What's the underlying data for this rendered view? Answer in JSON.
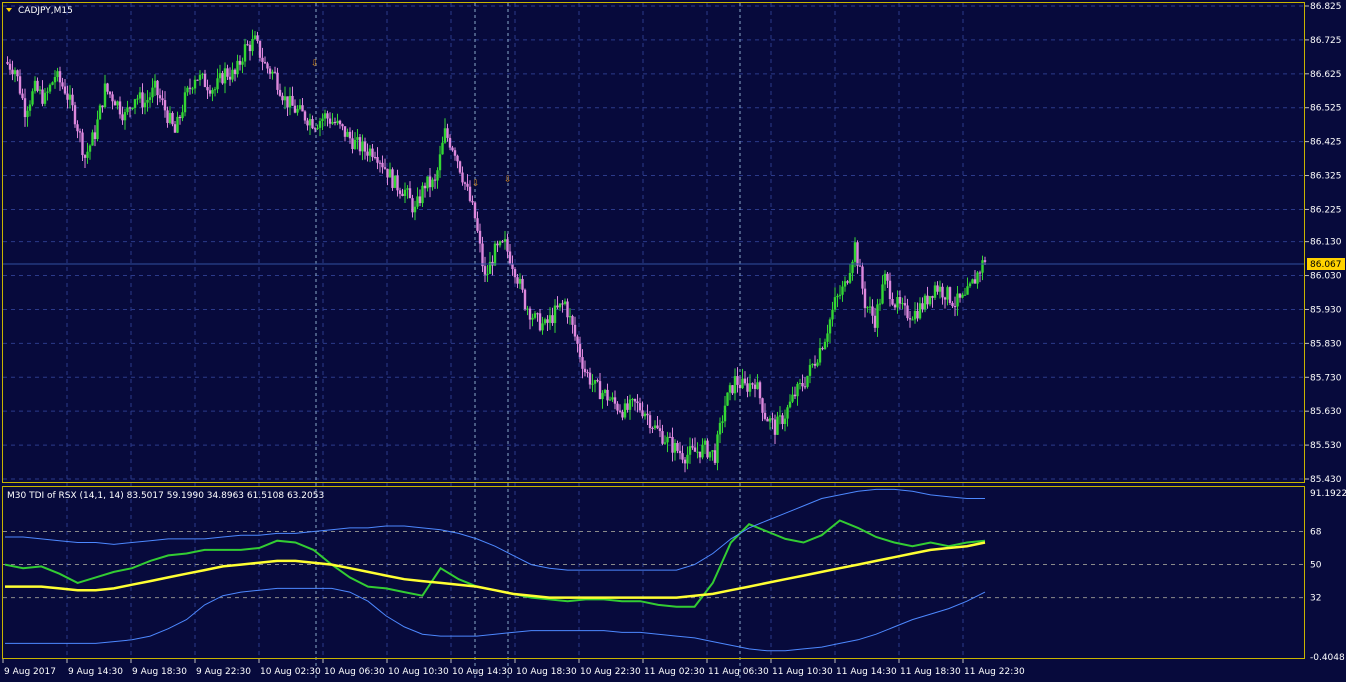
{
  "window": {
    "title": "CADJPY,M15"
  },
  "colors": {
    "background": "#070a3c",
    "grid": "#2b3a8a",
    "border": "#c8b400",
    "bull": "#33d633",
    "bear": "#dd88dd",
    "text": "#ffffff",
    "vline": "#8aa8c8",
    "price_tag_bg": "#ffd200",
    "tdi_green": "#33cc33",
    "tdi_yellow": "#ffff33",
    "tdi_blue": "#4d88ff",
    "arrow": "#d98a1a"
  },
  "price_axis": {
    "labels": [
      "86.825",
      "86.725",
      "86.625",
      "86.525",
      "86.425",
      "86.325",
      "86.225",
      "86.130",
      "86.030",
      "85.930",
      "85.830",
      "85.730",
      "85.630",
      "85.530",
      "85.430"
    ],
    "current_price": "86.067"
  },
  "indicator": {
    "label": "M30 TDI of RSX  (14,1, 14) 83.5017 59.1990 34.8963 61.5108 63.2053",
    "axis_labels": [
      "91.1922",
      "68",
      "50",
      "32",
      "-0.4048"
    ]
  },
  "time_axis": {
    "labels": [
      "9 Aug 2017",
      "9 Aug 14:30",
      "9 Aug 18:30",
      "9 Aug 22:30",
      "10 Aug 02:30",
      "10 Aug 06:30",
      "10 Aug 10:30",
      "10 Aug 14:30",
      "10 Aug 18:30",
      "10 Aug 22:30",
      "11 Aug 02:30",
      "11 Aug 06:30",
      "11 Aug 10:30",
      "11 Aug 14:30",
      "11 Aug 18:30",
      "11 Aug 22:30"
    ]
  },
  "chart_data": {
    "type": "candlestick",
    "symbol": "CADJPY",
    "timeframe": "M15",
    "y_range": [
      85.43,
      86.825
    ],
    "close_path": [
      [
        0,
        86.66
      ],
      [
        4,
        86.64
      ],
      [
        8,
        86.52
      ],
      [
        12,
        86.58
      ],
      [
        16,
        86.55
      ],
      [
        20,
        86.62
      ],
      [
        24,
        86.58
      ],
      [
        28,
        86.5
      ],
      [
        32,
        86.38
      ],
      [
        36,
        86.45
      ],
      [
        40,
        86.58
      ],
      [
        44,
        86.55
      ],
      [
        48,
        86.5
      ],
      [
        52,
        86.56
      ],
      [
        56,
        86.54
      ],
      [
        60,
        86.58
      ],
      [
        64,
        86.52
      ],
      [
        68,
        86.45
      ],
      [
        72,
        86.55
      ],
      [
        76,
        86.62
      ],
      [
        80,
        86.6
      ],
      [
        84,
        86.58
      ],
      [
        88,
        86.63
      ],
      [
        92,
        86.62
      ],
      [
        96,
        86.7
      ],
      [
        100,
        86.72
      ],
      [
        104,
        86.65
      ],
      [
        108,
        86.62
      ],
      [
        112,
        86.55
      ],
      [
        116,
        86.52
      ],
      [
        120,
        86.5
      ],
      [
        124,
        86.48
      ],
      [
        128,
        86.5
      ],
      [
        132,
        86.48
      ],
      [
        136,
        86.45
      ],
      [
        140,
        86.42
      ],
      [
        144,
        86.4
      ],
      [
        148,
        86.4
      ],
      [
        152,
        86.35
      ],
      [
        156,
        86.3
      ],
      [
        160,
        86.28
      ],
      [
        164,
        86.22
      ],
      [
        168,
        86.3
      ],
      [
        172,
        86.3
      ],
      [
        176,
        86.45
      ],
      [
        180,
        86.4
      ],
      [
        184,
        86.3
      ],
      [
        188,
        86.2
      ],
      [
        192,
        86.02
      ],
      [
        196,
        86.1
      ],
      [
        200,
        86.12
      ],
      [
        204,
        86.05
      ],
      [
        208,
        85.95
      ],
      [
        212,
        85.9
      ],
      [
        216,
        85.88
      ],
      [
        220,
        85.92
      ],
      [
        224,
        85.95
      ],
      [
        228,
        85.85
      ],
      [
        232,
        85.75
      ],
      [
        236,
        85.7
      ],
      [
        240,
        85.68
      ],
      [
        244,
        85.65
      ],
      [
        248,
        85.63
      ],
      [
        252,
        85.65
      ],
      [
        256,
        85.63
      ],
      [
        260,
        85.58
      ],
      [
        264,
        85.55
      ],
      [
        268,
        85.52
      ],
      [
        272,
        85.5
      ],
      [
        276,
        85.51
      ],
      [
        280,
        85.52
      ],
      [
        284,
        85.5
      ],
      [
        288,
        85.65
      ],
      [
        292,
        85.72
      ],
      [
        296,
        85.7
      ],
      [
        300,
        85.72
      ],
      [
        304,
        85.62
      ],
      [
        308,
        85.58
      ],
      [
        312,
        85.62
      ],
      [
        316,
        85.68
      ],
      [
        320,
        85.72
      ],
      [
        324,
        85.78
      ],
      [
        328,
        85.85
      ],
      [
        332,
        85.95
      ],
      [
        336,
        86.0
      ],
      [
        340,
        86.12
      ],
      [
        344,
        85.95
      ],
      [
        348,
        85.9
      ],
      [
        352,
        86.02
      ],
      [
        356,
        85.95
      ],
      [
        360,
        85.92
      ],
      [
        364,
        85.92
      ],
      [
        368,
        85.95
      ],
      [
        372,
        86.0
      ],
      [
        376,
        85.98
      ],
      [
        380,
        85.95
      ],
      [
        384,
        85.96
      ],
      [
        388,
        86.02
      ],
      [
        392,
        86.08
      ]
    ],
    "indicator_series": [
      {
        "name": "rsx",
        "values": [
          50,
          48,
          49,
          45,
          40,
          43,
          46,
          48,
          52,
          55,
          56,
          58,
          58,
          58,
          59,
          63,
          62,
          58,
          50,
          43,
          38,
          37,
          35,
          33,
          48,
          42,
          38,
          36,
          34,
          32,
          31,
          30,
          31,
          31,
          30,
          30,
          28,
          27,
          27,
          40,
          62,
          72,
          68,
          64,
          62,
          66,
          74,
          70,
          65,
          62,
          60,
          62,
          60,
          62,
          63
        ]
      },
      {
        "name": "signal",
        "values": [
          38,
          38,
          38,
          37,
          36,
          36,
          37,
          39,
          41,
          43,
          45,
          47,
          49,
          50,
          51,
          52,
          52,
          51,
          50,
          48,
          46,
          44,
          42,
          41,
          40,
          39,
          38,
          36,
          34,
          33,
          32,
          32,
          32,
          32,
          32,
          32,
          32,
          32,
          33,
          34,
          36,
          38,
          40,
          42,
          44,
          46,
          48,
          50,
          52,
          54,
          56,
          58,
          59,
          60,
          62
        ]
      },
      {
        "name": "band_upper",
        "values": [
          65,
          65,
          64,
          63,
          62,
          62,
          61,
          62,
          63,
          64,
          64,
          64,
          65,
          66,
          66,
          67,
          67,
          68,
          69,
          70,
          70,
          71,
          71,
          70,
          69,
          67,
          64,
          60,
          55,
          50,
          48,
          47,
          47,
          47,
          47,
          47,
          47,
          47,
          50,
          56,
          64,
          70,
          74,
          78,
          82,
          86,
          88,
          90,
          91,
          91,
          90,
          88,
          87,
          86,
          86
        ]
      },
      {
        "name": "band_lower",
        "values": [
          7,
          7,
          7,
          7,
          7,
          7,
          8,
          9,
          11,
          15,
          20,
          28,
          33,
          35,
          36,
          37,
          37,
          37,
          37,
          35,
          30,
          22,
          16,
          12,
          11,
          11,
          11,
          12,
          13,
          14,
          14,
          14,
          14,
          14,
          13,
          13,
          12,
          11,
          10,
          8,
          6,
          4,
          3,
          3,
          4,
          5,
          7,
          9,
          12,
          16,
          20,
          23,
          26,
          30,
          35
        ]
      }
    ]
  }
}
